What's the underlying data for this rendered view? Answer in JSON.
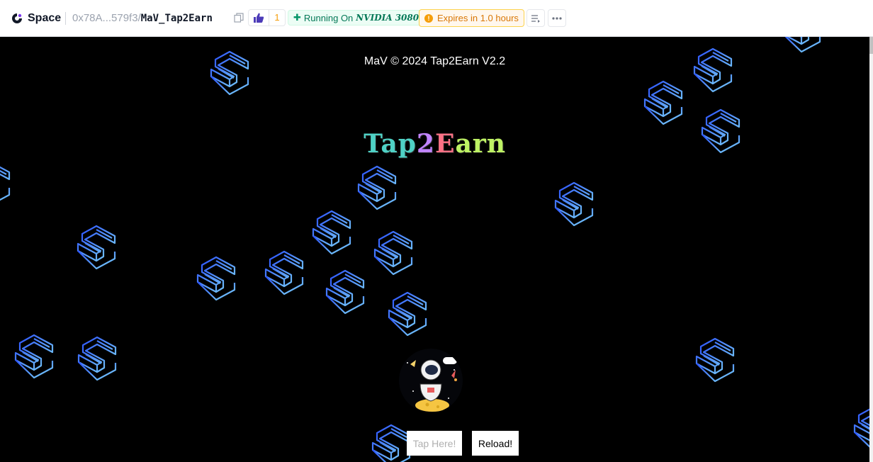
{
  "header": {
    "brand": "Space",
    "owner": "0x78A...579f3",
    "separator": "/",
    "space_name": "MaV_Tap2Earn",
    "likes": "1",
    "running_label": "Running On",
    "hardware": "NVIDIA 3080",
    "expires": "Expires in 1.0 hours"
  },
  "app": {
    "copyright": "MaV © 2024 Tap2Earn V2.2",
    "title": {
      "parts": [
        {
          "text": "Tap",
          "color": "#4fd1c5"
        },
        {
          "text": "2",
          "color": "#c084fc"
        },
        {
          "text": "E",
          "color": "#fb7185"
        },
        {
          "text": "arn",
          "color": "#bef264"
        }
      ]
    },
    "tap_button": "Tap Here!",
    "reload_button": "Reload!",
    "floating_icon": "s-logo-icon"
  },
  "colors": {
    "app_bg": "#000000",
    "floater_dark": "#2b52ff",
    "floater_light": "#7fd8f8",
    "running_green": "#047857",
    "expires_orange": "#d97706"
  }
}
